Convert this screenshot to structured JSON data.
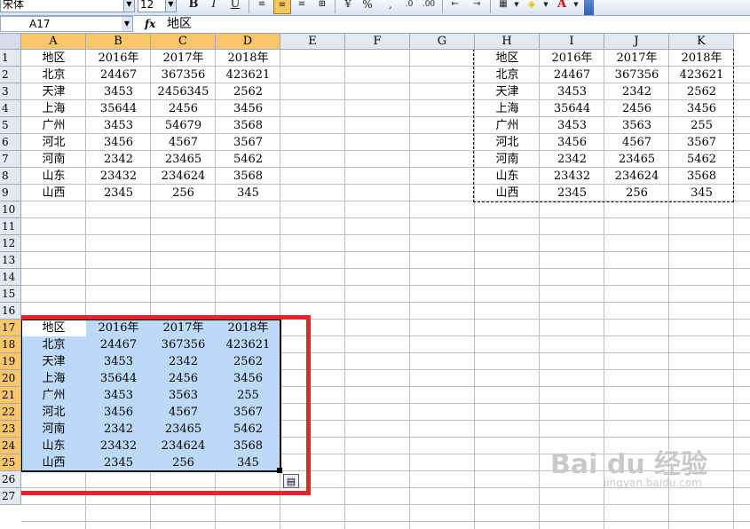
{
  "toolbar": {
    "font_name": "宋体",
    "font_size": "12",
    "bold": "B",
    "italic": "I",
    "underline": "U",
    "percent": "%",
    "comma": ","
  },
  "formula_bar": {
    "name_box": "A17",
    "fx": "fx",
    "content": "地区"
  },
  "columns": [
    "A",
    "B",
    "C",
    "D",
    "E",
    "F",
    "G",
    "H",
    "I",
    "J",
    "K"
  ],
  "rows": [
    "1",
    "2",
    "3",
    "4",
    "5",
    "6",
    "7",
    "8",
    "9",
    "10",
    "11",
    "12",
    "13",
    "14",
    "15",
    "16",
    "17",
    "18",
    "19",
    "20",
    "21",
    "22",
    "23",
    "24",
    "25",
    "26",
    "27"
  ],
  "source_table": [
    [
      "地区",
      "2016年",
      "2017年",
      "2018年"
    ],
    [
      "北京",
      "24467",
      "367356",
      "423621"
    ],
    [
      "天津",
      "3453",
      "2456345",
      "2562"
    ],
    [
      "上海",
      "35644",
      "2456",
      "3456"
    ],
    [
      "广州",
      "3453",
      "54679",
      "3568"
    ],
    [
      "河北",
      "3456",
      "4567",
      "3567"
    ],
    [
      "河南",
      "2342",
      "23465",
      "5462"
    ],
    [
      "山东",
      "23432",
      "234624",
      "3568"
    ],
    [
      "山西",
      "2345",
      "256",
      "345"
    ]
  ],
  "copied_table": [
    [
      "地区",
      "2016年",
      "2017年",
      "2018年"
    ],
    [
      "北京",
      "24467",
      "367356",
      "423621"
    ],
    [
      "天津",
      "3453",
      "2342",
      "2562"
    ],
    [
      "上海",
      "35644",
      "2456",
      "3456"
    ],
    [
      "广州",
      "3453",
      "3563",
      "255"
    ],
    [
      "河北",
      "3456",
      "4567",
      "3567"
    ],
    [
      "河南",
      "2342",
      "23465",
      "5462"
    ],
    [
      "山东",
      "23432",
      "234624",
      "3568"
    ],
    [
      "山西",
      "2345",
      "256",
      "345"
    ]
  ],
  "pasted_table": [
    [
      "地区",
      "2016年",
      "2017年",
      "2018年"
    ],
    [
      "北京",
      "24467",
      "367356",
      "423621"
    ],
    [
      "天津",
      "3453",
      "2342",
      "2562"
    ],
    [
      "上海",
      "35644",
      "2456",
      "3456"
    ],
    [
      "广州",
      "3453",
      "3563",
      "255"
    ],
    [
      "河北",
      "3456",
      "4567",
      "3567"
    ],
    [
      "河南",
      "2342",
      "23465",
      "5462"
    ],
    [
      "山东",
      "23432",
      "234624",
      "3568"
    ],
    [
      "山西",
      "2345",
      "256",
      "345"
    ]
  ],
  "colors": {
    "selection": "#bcd9f7",
    "highlight_box": "#e8232a",
    "header_selected": "#f9c66b"
  },
  "watermark": {
    "brand": "Bai du 经验",
    "url": "jingyan.baidu.com"
  }
}
